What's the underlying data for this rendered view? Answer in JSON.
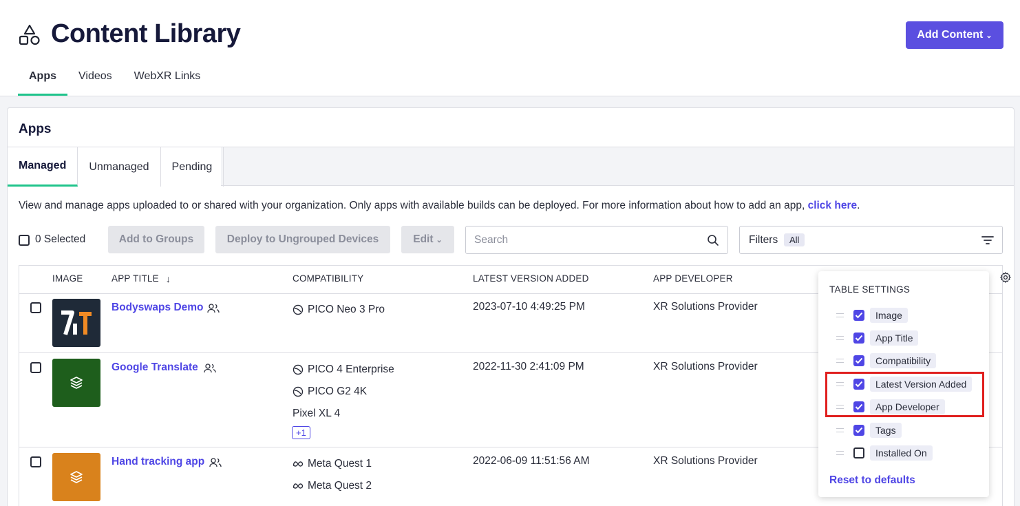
{
  "header": {
    "title": "Content Library",
    "icon": "shapes-icon",
    "add_button": "Add Content",
    "tabs": [
      {
        "label": "Apps",
        "active": true
      },
      {
        "label": "Videos",
        "active": false
      },
      {
        "label": "WebXR Links",
        "active": false
      }
    ]
  },
  "card": {
    "title": "Apps",
    "tabs": [
      {
        "label": "Managed",
        "active": true
      },
      {
        "label": "Unmanaged",
        "active": false
      },
      {
        "label": "Pending",
        "active": false
      }
    ],
    "description": "View and manage apps uploaded to or shared with your organization. Only apps with available builds can be deployed. For more information about how to add an app, ",
    "description_link": "click here",
    "description_end": "."
  },
  "toolbar": {
    "selected": "0 Selected",
    "add_to_groups": "Add to Groups",
    "deploy": "Deploy to Ungrouped Devices",
    "edit": "Edit",
    "search_placeholder": "Search",
    "filters_label": "Filters",
    "filters_badge": "All"
  },
  "table": {
    "columns": [
      "IMAGE",
      "APP TITLE",
      "COMPATIBILITY",
      "LATEST VERSION ADDED",
      "APP DEVELOPER"
    ],
    "rows": [
      {
        "title": "Bodyswaps Demo",
        "compatibility": [
          "PICO Neo 3 Pro"
        ],
        "latest_version": "2023-07-10 4:49:25 PM",
        "developer": "XR Solutions Provider"
      },
      {
        "title": "Google Translate",
        "compatibility": [
          "PICO 4 Enterprise",
          "PICO G2 4K",
          "Pixel XL 4"
        ],
        "more": "+1",
        "latest_version": "2022-11-30 2:41:09 PM",
        "developer": "XR Solutions Provider"
      },
      {
        "title": "Hand tracking app",
        "compatibility": [
          "Meta Quest 1",
          "Meta Quest 2"
        ],
        "latest_version": "2022-06-09 11:51:56 AM",
        "developer": "XR Solutions Provider"
      }
    ]
  },
  "table_settings": {
    "title": "TABLE SETTINGS",
    "items": [
      {
        "label": "Image",
        "checked": true
      },
      {
        "label": "App Title",
        "checked": true
      },
      {
        "label": "Compatibility",
        "checked": true
      },
      {
        "label": "Latest Version Added",
        "checked": true
      },
      {
        "label": "App Developer",
        "checked": true
      },
      {
        "label": "Tags",
        "checked": true
      },
      {
        "label": "Installed On",
        "checked": false
      }
    ],
    "reset": "Reset to defaults"
  },
  "colors": {
    "accent": "#5b4fe0",
    "link": "#4f46e5",
    "active_tab": "#1fc48b",
    "highlight": "#e0201f",
    "app_colors": [
      "#1f2a38",
      "#1e5e1c",
      "#d9821c"
    ]
  }
}
